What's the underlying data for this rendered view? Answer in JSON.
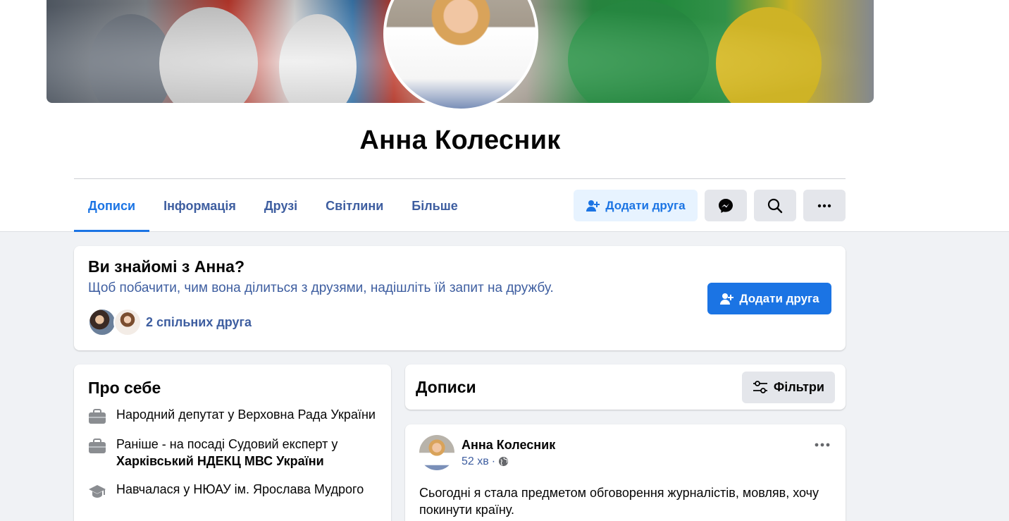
{
  "profile": {
    "name": "Анна Колесник"
  },
  "tabs": [
    {
      "label": "Дописи"
    },
    {
      "label": "Інформація"
    },
    {
      "label": "Друзі"
    },
    {
      "label": "Світлини"
    },
    {
      "label": "Більше"
    }
  ],
  "actions": {
    "add_friend_label": "Додати друга",
    "messenger_icon": "messenger-icon",
    "search_icon": "search-icon",
    "more_icon": "more-icon"
  },
  "know_card": {
    "title": "Ви знайомі з Анна?",
    "subtitle": "Щоб побачити, чим вона ділиться з друзями, надішліть їй запит на дружбу.",
    "mutual_friends": "2 спільних друга",
    "button_label": "Додати друга"
  },
  "about": {
    "title": "Про себе",
    "items": [
      {
        "icon": "briefcase-icon",
        "text": "Народний депутат у Верховна Рада України",
        "bold": ""
      },
      {
        "icon": "briefcase-icon",
        "text": "Раніше - на посаді Судовий експерт у",
        "bold": "Харківський НДЕКЦ МВС України"
      },
      {
        "icon": "graduation-cap-icon",
        "text": "Навчалася у НЮАУ ім. Ярослава Мудрого",
        "bold": ""
      }
    ]
  },
  "posts": {
    "title": "Дописи",
    "filter_label": "Фільтри",
    "items": [
      {
        "author": "Анна Колесник",
        "time": "52 хв",
        "dot": "·",
        "text": "Сьогодні я стала предметом обговорення журналістів, мовляв, хочу покинути країну."
      }
    ]
  },
  "colors": {
    "accent": "#1b74e4",
    "link": "#3e5ea0",
    "background": "#f0f2f5"
  }
}
